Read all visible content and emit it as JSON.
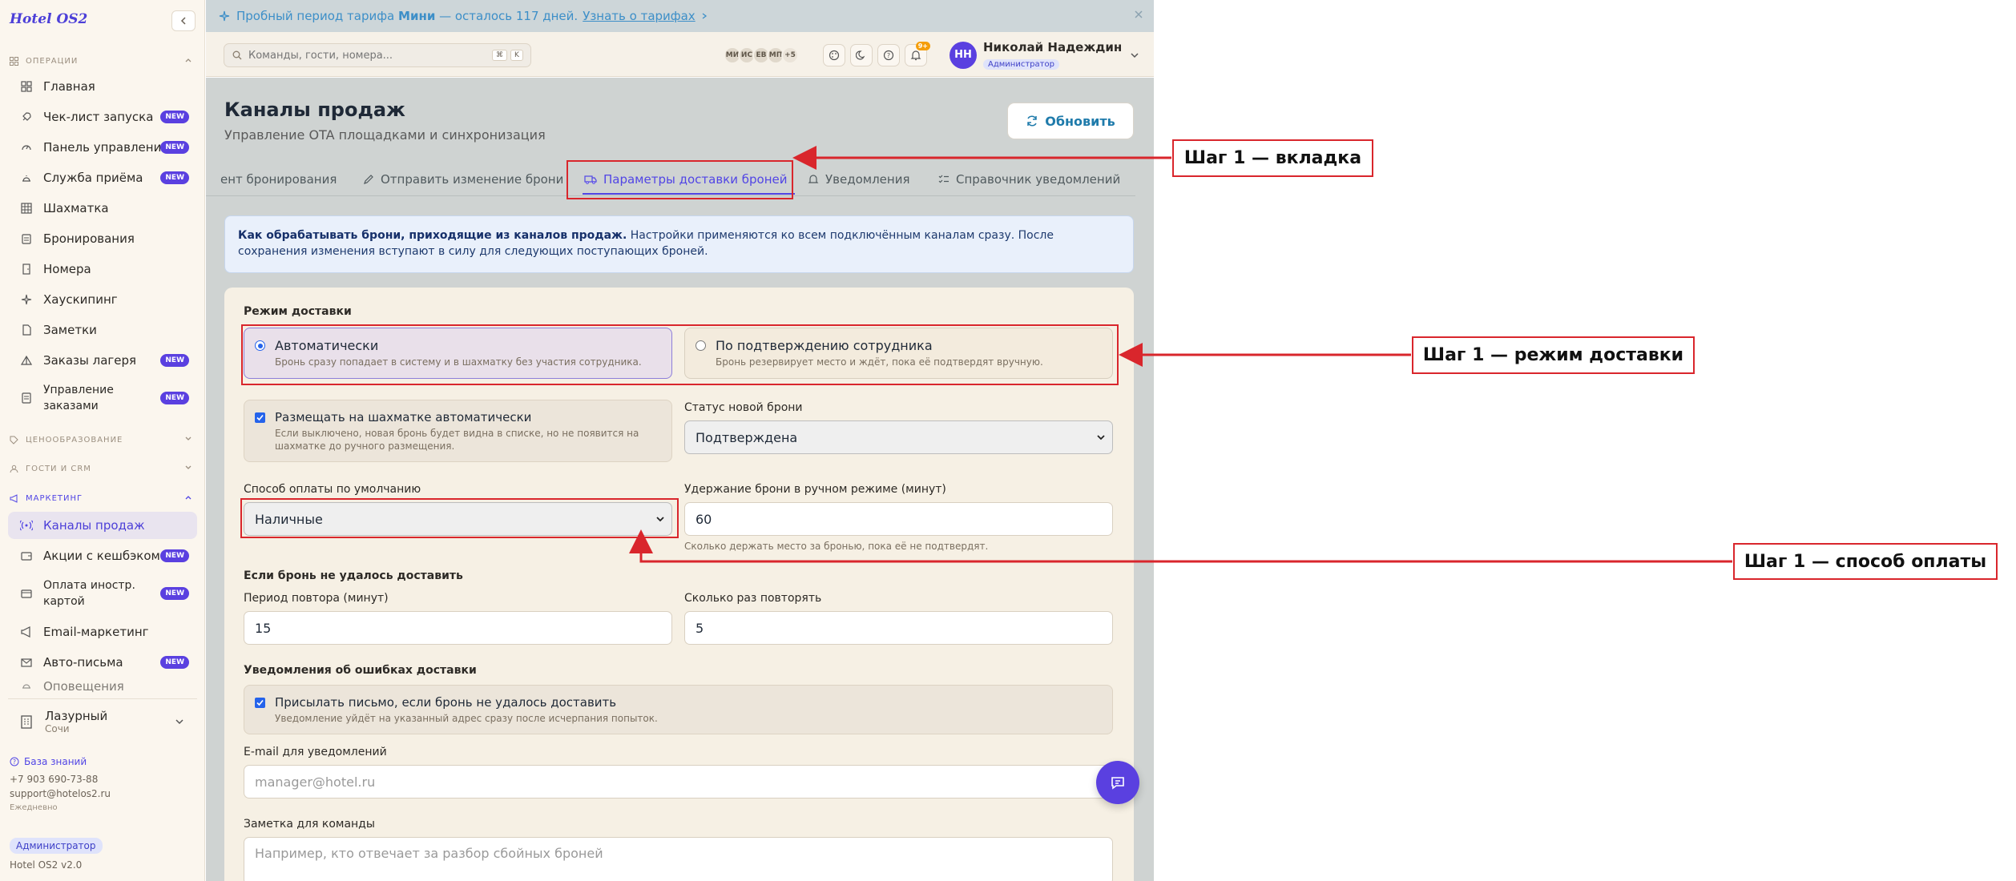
{
  "brand": "Hotel OS2",
  "sidebar": {
    "sections": {
      "operations": "Операции",
      "pricing": "Ценообразование",
      "guests": "Гости и CRM",
      "marketing": "Маркетинг"
    },
    "items": [
      {
        "label": "Главная",
        "icon": "grid-icon"
      },
      {
        "label": "Чек-лист запуска",
        "icon": "rocket-icon",
        "badge": "NEW"
      },
      {
        "label": "Панель управления",
        "icon": "gauge-icon",
        "badge": "NEW"
      },
      {
        "label": "Служба приёма",
        "icon": "bell-icon",
        "badge": "NEW"
      },
      {
        "label": "Шахматка",
        "icon": "table-icon"
      },
      {
        "label": "Бронирования",
        "icon": "clipboard-icon"
      },
      {
        "label": "Номера",
        "icon": "door-icon"
      },
      {
        "label": "Хаускипинг",
        "icon": "sparkle-icon"
      },
      {
        "label": "Заметки",
        "icon": "note-icon"
      },
      {
        "label": "Заказы лагеря",
        "icon": "tent-icon",
        "badge": "NEW"
      },
      {
        "label": "Управление заказами",
        "icon": "list-icon",
        "badge": "NEW"
      },
      {
        "label": "Каналы продаж",
        "icon": "broadcast-icon"
      },
      {
        "label": "Акции с кешбэком",
        "icon": "wallet-icon",
        "badge": "NEW"
      },
      {
        "label": "Оплата иностр. картой",
        "icon": "card-icon",
        "badge": "NEW"
      },
      {
        "label": "Email-маркетинг",
        "icon": "megaphone-icon"
      },
      {
        "label": "Авто-письма",
        "icon": "mail-icon",
        "badge": "NEW"
      },
      {
        "label": "Оповещения",
        "icon": "bell-icon"
      }
    ],
    "hotel": {
      "name": "Лазурный",
      "city": "Сочи"
    },
    "support": {
      "kb": "База знаний",
      "phone": "+7 903 690-73-88",
      "email": "support@hotelos2.ru",
      "hours": "Ежедневно"
    },
    "role": "Администратор",
    "version": "Hotel OS2 v2.0"
  },
  "promo": {
    "prefix": "Пробный период тарифа",
    "plan": "Мини",
    "suffix": "— осталось 117 дней.",
    "link": "Узнать о тарифах"
  },
  "topbar": {
    "search_placeholder": "Команды, гости, номера...",
    "kbd1": "⌘",
    "kbd2": "K",
    "avatars": [
      "МИ",
      "ИС",
      "ЕВ",
      "МП",
      "+5"
    ],
    "notif_count": "9+",
    "user_initials": "НН",
    "user_name": "Николай Надеждин",
    "user_role": "Администратор"
  },
  "page": {
    "title": "Каналы продаж",
    "subtitle": "Управление OTA площадками и синхронизация",
    "refresh": "Обновить",
    "tabs": [
      "ент бронирования",
      "Отправить изменение брони",
      "Параметры доставки броней",
      "Уведомления",
      "Справочник уведомлений"
    ],
    "info_bold": "Как обрабатывать брони, приходящие из каналов продаж.",
    "info_text": "Настройки применяются ко всем подключённым каналам сразу. После сохранения изменения вступают в силу для следующих поступающих броней."
  },
  "form": {
    "mode_label": "Режим доставки",
    "mode_auto_title": "Автоматически",
    "mode_auto_desc": "Бронь сразу попадает в систему и в шахматку без участия сотрудника.",
    "mode_manual_title": "По подтверждению сотрудника",
    "mode_manual_desc": "Бронь резервирует место и ждёт, пока её подтвердят вручную.",
    "place_title": "Размещать на шахматке автоматически",
    "place_desc": "Если выключено, новая бронь будет видна в списке, но не появится на шахматке до ручного размещения.",
    "status_label": "Статус новой брони",
    "status_value": "Подтверждена",
    "payment_label": "Способ оплаты по умолчанию",
    "payment_value": "Наличные",
    "hold_label": "Удержание брони в ручном режиме (минут)",
    "hold_value": "60",
    "hold_hint": "Сколько держать место за бронью, пока её не подтвердят.",
    "retry_section": "Если бронь не удалось доставить",
    "retry_period_label": "Период повтора (минут)",
    "retry_period_value": "15",
    "retry_count_label": "Сколько раз повторять",
    "retry_count_value": "5",
    "errors_section": "Уведомления об ошибках доставки",
    "notify_title": "Присылать письмо, если бронь не удалось доставить",
    "notify_desc": "Уведомление уйдёт на указанный адрес сразу после исчерпания попыток.",
    "email_label": "E-mail для уведомлений",
    "email_placeholder": "manager@hotel.ru",
    "note_label": "Заметка для команды",
    "note_placeholder": "Например, кто отвечает за разбор сбойных броней"
  },
  "annotations": {
    "tab": "Шаг 1 — вкладка",
    "mode": "Шаг 1 — режим доставки",
    "payment": "Шаг 1 — способ оплаты"
  },
  "colors": {
    "accent": "#5145e5",
    "annotation": "#d9262c",
    "badge": "#5a40e0"
  }
}
